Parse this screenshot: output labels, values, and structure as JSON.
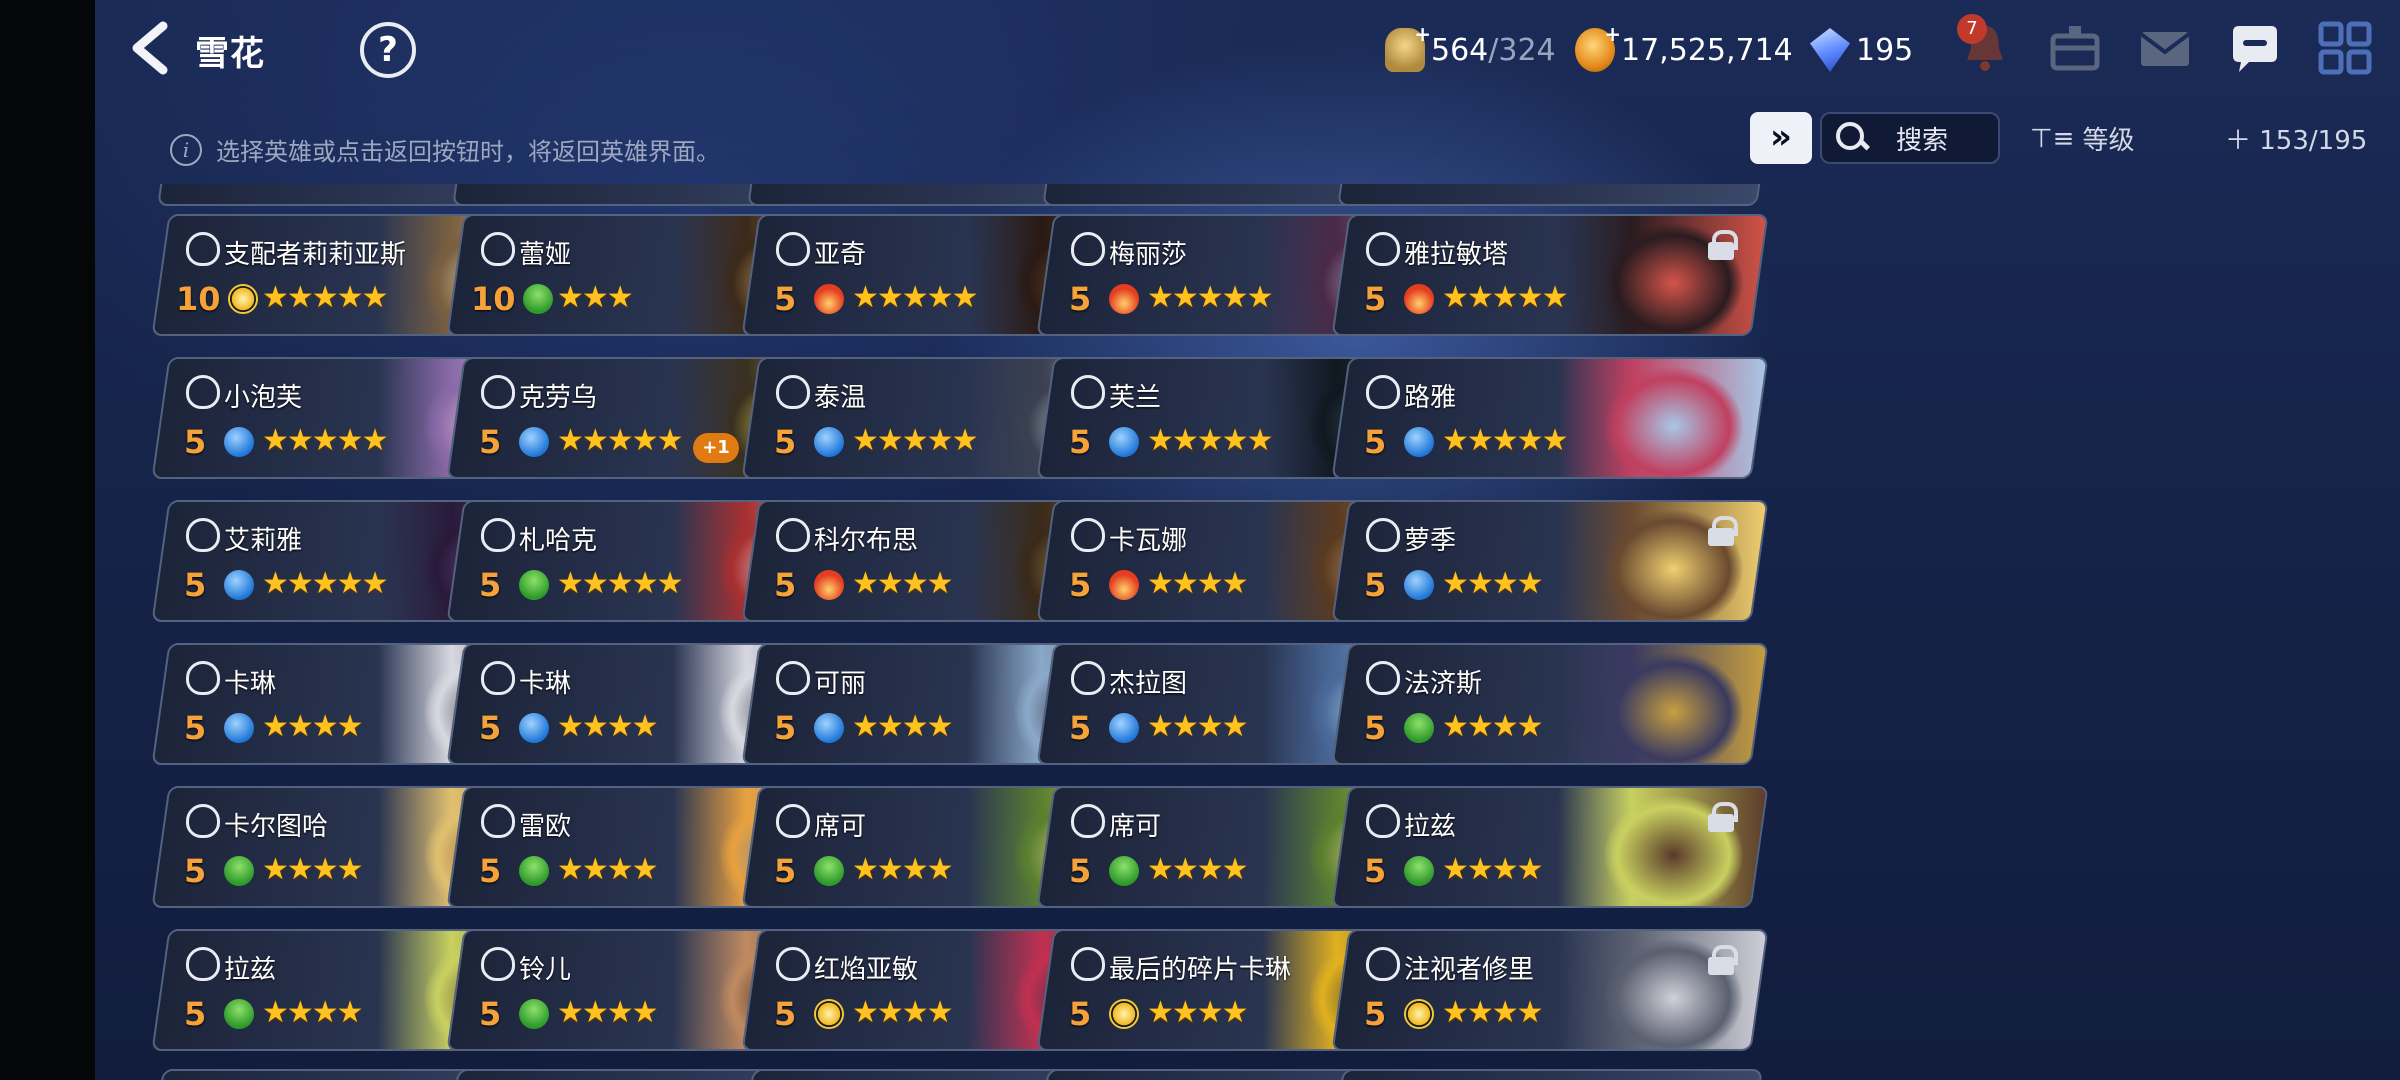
{
  "header": {
    "title": "雪花",
    "resources": {
      "stamina_current": "564",
      "stamina_max": "/324",
      "gold": "17,525,714",
      "gems": "195"
    },
    "notification_count": "7"
  },
  "toolbar": {
    "tip": "选择英雄或点击返回按钮时，将返回英雄界面。",
    "skip_label": "»",
    "search_label": "搜索",
    "sort_label": "等级",
    "hero_slots": "153/195"
  },
  "heroes": [
    {
      "name": "支配者莉莉亚斯",
      "level": "10",
      "element": "light",
      "stars": "★★★★★",
      "locked": false
    },
    {
      "name": "蕾娅",
      "level": "10",
      "element": "wood",
      "stars": "★★★",
      "locked": false
    },
    {
      "name": "亚奇",
      "level": "5",
      "element": "fire",
      "stars": "★★★★★",
      "locked": false
    },
    {
      "name": "梅丽莎",
      "level": "5",
      "element": "fire",
      "stars": "★★★★★",
      "locked": false
    },
    {
      "name": "雅拉敏塔",
      "level": "5",
      "element": "fire",
      "stars": "★★★★★",
      "locked": true
    },
    {
      "name": "小泡芙",
      "level": "5",
      "element": "water",
      "stars": "★★★★★",
      "locked": false
    },
    {
      "name": "克劳乌",
      "level": "5",
      "element": "water",
      "stars": "★★★★★",
      "locked": true,
      "bonus": "+1"
    },
    {
      "name": "泰温",
      "level": "5",
      "element": "water",
      "stars": "★★★★★",
      "locked": false
    },
    {
      "name": "芙兰",
      "level": "5",
      "element": "water",
      "stars": "★★★★★",
      "locked": false
    },
    {
      "name": "路雅",
      "level": "5",
      "element": "water",
      "stars": "★★★★★",
      "locked": false
    },
    {
      "name": "艾莉雅",
      "level": "5",
      "element": "water",
      "stars": "★★★★★",
      "locked": false
    },
    {
      "name": "札哈克",
      "level": "5",
      "element": "wood",
      "stars": "★★★★★",
      "locked": true
    },
    {
      "name": "科尔布思",
      "level": "5",
      "element": "fire",
      "stars": "★★★★",
      "locked": true
    },
    {
      "name": "卡瓦娜",
      "level": "5",
      "element": "fire",
      "stars": "★★★★",
      "locked": true
    },
    {
      "name": "萝季",
      "level": "5",
      "element": "water",
      "stars": "★★★★",
      "locked": true
    },
    {
      "name": "卡琳",
      "level": "5",
      "element": "water",
      "stars": "★★★★",
      "locked": false
    },
    {
      "name": "卡琳",
      "level": "5",
      "element": "water",
      "stars": "★★★★",
      "locked": false
    },
    {
      "name": "可丽",
      "level": "5",
      "element": "water",
      "stars": "★★★★",
      "locked": false
    },
    {
      "name": "杰拉图",
      "level": "5",
      "element": "water",
      "stars": "★★★★",
      "locked": false
    },
    {
      "name": "法济斯",
      "level": "5",
      "element": "wood",
      "stars": "★★★★",
      "locked": false
    },
    {
      "name": "卡尔图哈",
      "level": "5",
      "element": "wood",
      "stars": "★★★★",
      "locked": true
    },
    {
      "name": "雷欧",
      "level": "5",
      "element": "wood",
      "stars": "★★★★",
      "locked": true
    },
    {
      "name": "席可",
      "level": "5",
      "element": "wood",
      "stars": "★★★★",
      "locked": false
    },
    {
      "name": "席可",
      "level": "5",
      "element": "wood",
      "stars": "★★★★",
      "locked": false
    },
    {
      "name": "拉兹",
      "level": "5",
      "element": "wood",
      "stars": "★★★★",
      "locked": true
    },
    {
      "name": "拉兹",
      "level": "5",
      "element": "wood",
      "stars": "★★★★",
      "locked": false
    },
    {
      "name": "铃儿",
      "level": "5",
      "element": "wood",
      "stars": "★★★★",
      "locked": true
    },
    {
      "name": "红焰亚敏",
      "level": "5",
      "element": "light",
      "stars": "★★★★",
      "locked": true
    },
    {
      "name": "最后的碎片卡琳",
      "level": "5",
      "element": "light",
      "stars": "★★★★",
      "locked": true
    },
    {
      "name": "注视者修里",
      "level": "5",
      "element": "light",
      "stars": "★★★★",
      "locked": true
    }
  ],
  "colors": {
    "accent_orange": "#f5a23a",
    "star_gold": "#ffc21e",
    "card_border": "#52627f"
  }
}
